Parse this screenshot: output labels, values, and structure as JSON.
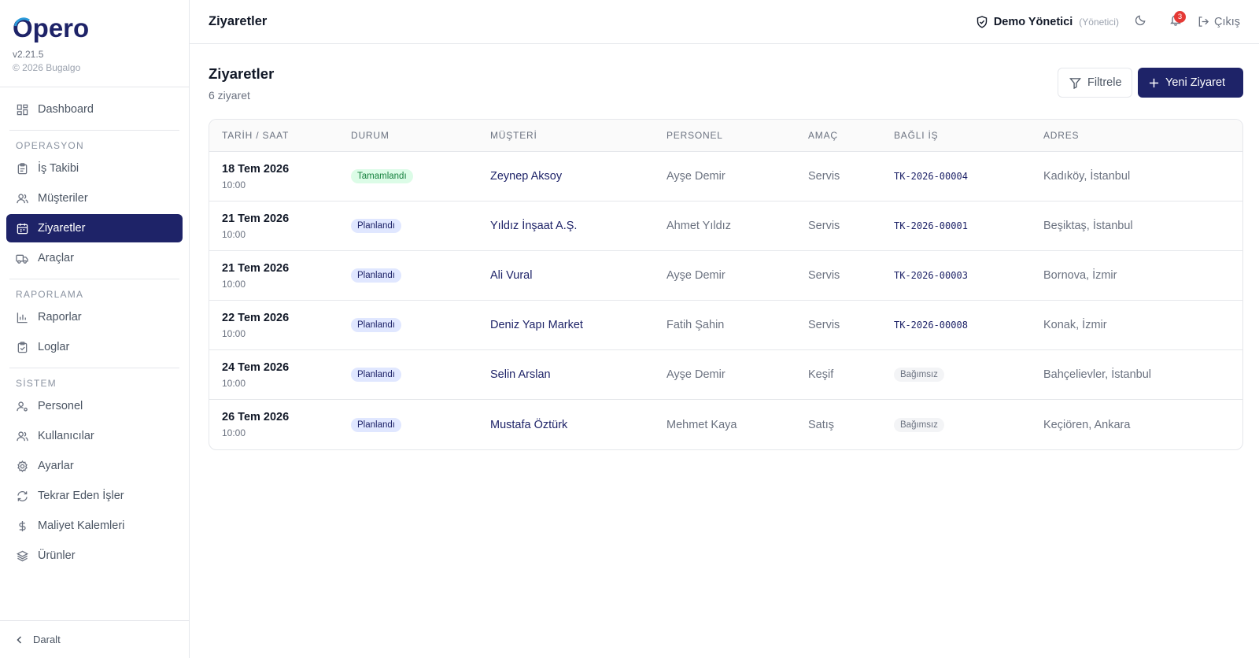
{
  "brand": {
    "logo_text": "Opero",
    "version": "v2.21.5",
    "copyright": "© 2026 Bugalgo",
    "accent_color": "#1e2368"
  },
  "sidebar": {
    "dashboard": {
      "label": "Dashboard",
      "icon": "dashboard-icon"
    },
    "sections": [
      {
        "title": "OPERASYON",
        "items": [
          {
            "label": "İş Takibi",
            "icon": "clipboard-icon"
          },
          {
            "label": "Müşteriler",
            "icon": "users-icon"
          },
          {
            "label": "Ziyaretler",
            "icon": "calendar-icon",
            "active": true
          },
          {
            "label": "Araçlar",
            "icon": "truck-icon"
          }
        ]
      },
      {
        "title": "RAPORLAMA",
        "items": [
          {
            "label": "Raporlar",
            "icon": "bar-chart-icon"
          },
          {
            "label": "Loglar",
            "icon": "clipboard-check-icon"
          }
        ]
      },
      {
        "title": "SİSTEM",
        "items": [
          {
            "label": "Personel",
            "icon": "user-cog-icon"
          },
          {
            "label": "Kullanıcılar",
            "icon": "users-icon"
          },
          {
            "label": "Ayarlar",
            "icon": "gear-icon"
          },
          {
            "label": "Tekrar Eden İşler",
            "icon": "refresh-icon"
          },
          {
            "label": "Maliyet Kalemleri",
            "icon": "dollar-icon"
          },
          {
            "label": "Ürünler",
            "icon": "layers-icon"
          }
        ]
      }
    ],
    "collapse_label": "Daralt"
  },
  "topbar": {
    "title": "Ziyaretler",
    "user_name": "Demo Yönetici",
    "user_role": "(Yönetici)",
    "notification_count": "3",
    "logout_label": "Çıkış"
  },
  "main": {
    "title": "Ziyaretler",
    "count_text": "6 ziyaret",
    "filter_label": "Filtrele",
    "new_label": "Yeni Ziyaret",
    "columns": [
      "TARİH / SAAT",
      "DURUM",
      "MÜŞTERİ",
      "PERSONEL",
      "AMAÇ",
      "BAĞLI İŞ",
      "ADRES"
    ],
    "rows": [
      {
        "date": "18 Tem 2026",
        "time": "10:00",
        "status": "Tamamlandı",
        "status_kind": "done",
        "customer": "Zeynep Aksoy",
        "staff": "Ayşe Demir",
        "purpose": "Servis",
        "job": "TK-2026-00004",
        "job_kind": "code",
        "address": "Kadıköy, İstanbul"
      },
      {
        "date": "21 Tem 2026",
        "time": "10:00",
        "status": "Planlandı",
        "status_kind": "plan",
        "customer": "Yıldız İnşaat A.Ş.",
        "staff": "Ahmet Yıldız",
        "purpose": "Servis",
        "job": "TK-2026-00001",
        "job_kind": "code",
        "address": "Beşiktaş, İstanbul"
      },
      {
        "date": "21 Tem 2026",
        "time": "10:00",
        "status": "Planlandı",
        "status_kind": "plan",
        "customer": "Ali Vural",
        "staff": "Ayşe Demir",
        "purpose": "Servis",
        "job": "TK-2026-00003",
        "job_kind": "code",
        "address": "Bornova, İzmir"
      },
      {
        "date": "22 Tem 2026",
        "time": "10:00",
        "status": "Planlandı",
        "status_kind": "plan",
        "customer": "Deniz Yapı Market",
        "staff": "Fatih Şahin",
        "purpose": "Servis",
        "job": "TK-2026-00008",
        "job_kind": "code",
        "address": "Konak, İzmir"
      },
      {
        "date": "24 Tem 2026",
        "time": "10:00",
        "status": "Planlandı",
        "status_kind": "plan",
        "customer": "Selin Arslan",
        "staff": "Ayşe Demir",
        "purpose": "Keşif",
        "job": "Bağımsız",
        "job_kind": "free",
        "address": "Bahçelievler, İstanbul"
      },
      {
        "date": "26 Tem 2026",
        "time": "10:00",
        "status": "Planlandı",
        "status_kind": "plan",
        "customer": "Mustafa Öztürk",
        "staff": "Mehmet Kaya",
        "purpose": "Satış",
        "job": "Bağımsız",
        "job_kind": "free",
        "address": "Keçiören, Ankara"
      }
    ]
  }
}
